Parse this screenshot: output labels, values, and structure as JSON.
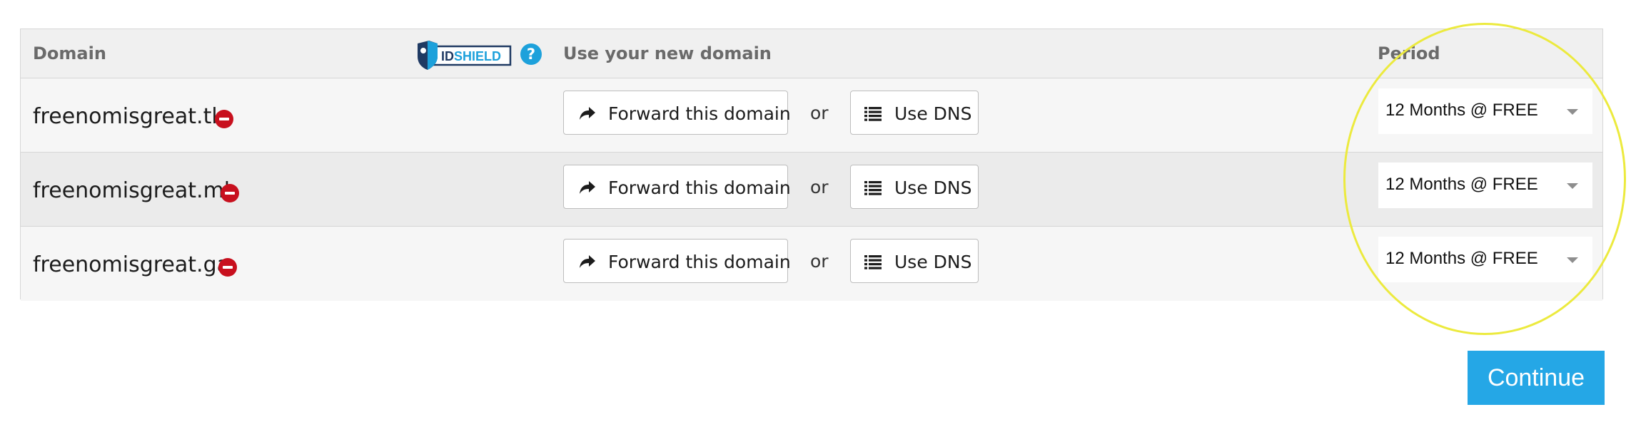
{
  "header": {
    "domain_label": "Domain",
    "idshield_logo": "IDSHIELD",
    "help_icon": "?",
    "use_label": "Use your new domain",
    "period_label": "Period"
  },
  "rows": [
    {
      "domain": "freenomisgreat.tk",
      "forward_label": "Forward this domain",
      "or_label": "or",
      "dns_label": "Use DNS",
      "period": "12 Months @ FREE"
    },
    {
      "domain": "freenomisgreat.ml",
      "forward_label": "Forward this domain",
      "or_label": "or",
      "dns_label": "Use DNS",
      "period": "12 Months @ FREE"
    },
    {
      "domain": "freenomisgreat.ga",
      "forward_label": "Forward this domain",
      "or_label": "or",
      "dns_label": "Use DNS",
      "period": "12 Months @ FREE"
    }
  ],
  "continue_label": "Continue",
  "colors": {
    "accent": "#25a7e6",
    "remove": "#c8101e",
    "highlight_circle": "#ecea3e"
  },
  "icons": {
    "remove": "remove-icon",
    "forward": "share-arrow-icon",
    "dns": "list-icon",
    "help": "help-icon",
    "caret": "chevron-down-icon"
  }
}
